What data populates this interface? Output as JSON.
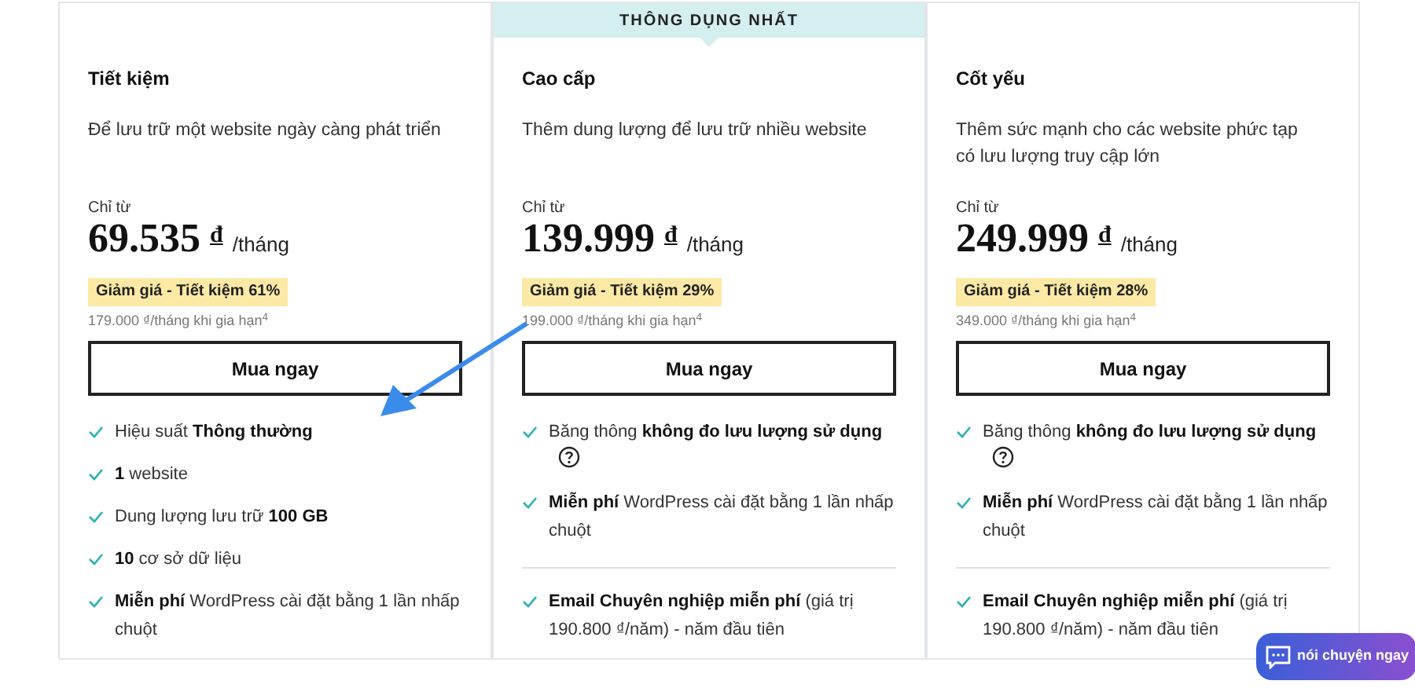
{
  "plans": [
    {
      "name": "Tiết kiệm",
      "description": "Để lưu trữ một website ngày càng phát triển",
      "price_prefix": "Chỉ từ",
      "price": "69.535",
      "currency": "đ",
      "period": "/tháng",
      "discount": "Giảm giá - Tiết kiệm 61%",
      "renewal": "179.000 ₫/tháng khi gia hạn$^{4}$",
      "button": "Mua ngay",
      "features": [
        {
          "text": "Hiệu suất **Thông thường**",
          "help": false,
          "divider_before": false
        },
        {
          "text": "**1** website",
          "help": false,
          "divider_before": false
        },
        {
          "text": "Dung lượng lưu trữ **100 GB**",
          "help": false,
          "divider_before": false
        },
        {
          "text": "**10** cơ sở dữ liệu",
          "help": false,
          "divider_before": false
        },
        {
          "text": "**Miễn phí** WordPress cài đặt bằng 1 lần nhấp chuột",
          "help": false,
          "divider_before": false
        }
      ]
    },
    {
      "ribbon": "THÔNG DỤNG NHẤT",
      "name": "Cao cấp",
      "description": "Thêm dung lượng để lưu trữ nhiều website",
      "price_prefix": "Chỉ từ",
      "price": "139.999",
      "currency": "đ",
      "period": "/tháng",
      "discount": "Giảm giá - Tiết kiệm 29%",
      "renewal": "199.000 ₫/tháng khi gia hạn$^{4}$",
      "button": "Mua ngay",
      "features": [
        {
          "text": "Băng thông **không đo lưu lượng sử dụng**",
          "help": true,
          "divider_before": false
        },
        {
          "text": "**Miễn phí** WordPress cài đặt bằng 1 lần nhấp chuột",
          "help": false,
          "divider_before": false
        },
        {
          "text": "**Email Chuyên nghiệp miễn phí** (giá trị 190.800 ₫/năm) - năm đầu tiên",
          "help": false,
          "divider_before": true
        }
      ]
    },
    {
      "name": "Cốt yếu",
      "description": "Thêm sức mạnh cho các website phức tạp có lưu lượng truy cập lớn",
      "price_prefix": "Chỉ từ",
      "price": "249.999",
      "currency": "đ",
      "period": "/tháng",
      "discount": "Giảm giá - Tiết kiệm 28%",
      "renewal": "349.000 ₫/tháng khi gia hạn$^{4}$",
      "button": "Mua ngay",
      "features": [
        {
          "text": "Băng thông **không đo lưu lượng sử dụng**",
          "help": true,
          "divider_before": false
        },
        {
          "text": "**Miễn phí** WordPress cài đặt bằng 1 lần nhấp chuột",
          "help": false,
          "divider_before": false
        },
        {
          "text": "**Email Chuyên nghiệp miễn phí** (giá trị 190.800 ₫/năm) - năm đầu tiên",
          "help": false,
          "divider_before": true
        }
      ]
    }
  ],
  "chat_button": {
    "label": "nói chuyện ngay"
  }
}
